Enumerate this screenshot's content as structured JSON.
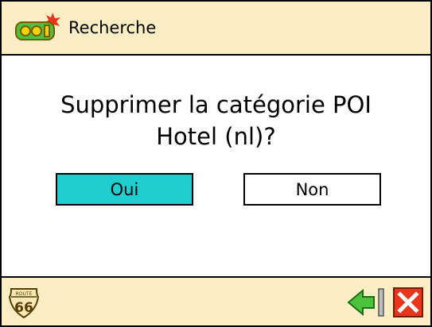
{
  "titlebar": {
    "title": "Recherche",
    "icon": "poi-icon"
  },
  "dialog": {
    "question_line1": "Supprimer la catégorie POI",
    "question_line2": "Hotel (nl)?",
    "yes_label": "Oui",
    "no_label": "Non"
  },
  "bottombar": {
    "logo_top": "ROUTE",
    "logo_number": "66",
    "back_icon": "back-arrow-icon",
    "close_icon": "close-icon"
  },
  "colors": {
    "bar_background": "#fbeec4",
    "selected_button": "#1fcfcf",
    "close_red": "#e8351c",
    "back_green": "#4cc33c"
  }
}
